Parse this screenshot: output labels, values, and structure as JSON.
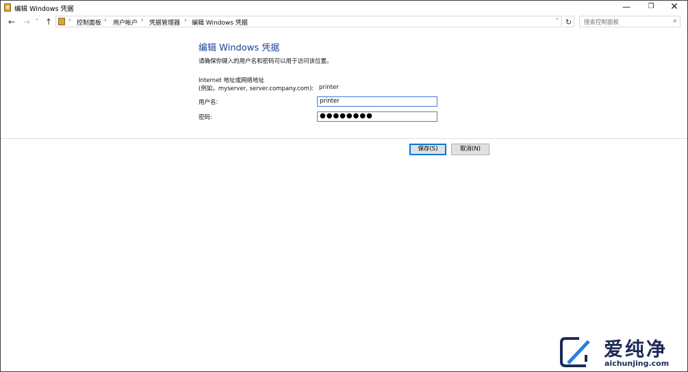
{
  "window": {
    "title": "编辑 Windows 凭据",
    "controls": {
      "minimize": "—",
      "maximize": "❐",
      "close": "✕"
    }
  },
  "nav": {
    "back": "←",
    "forward": "→",
    "recent": "˅",
    "up": "↑",
    "breadcrumbs": [
      "控制面板",
      "用户帐户",
      "凭据管理器",
      "编辑 Windows 凭据"
    ],
    "separator": "›",
    "dropdown": "˅",
    "refresh": "↻",
    "search_placeholder": "搜索控制面板",
    "search_icon": "⌕"
  },
  "form": {
    "heading": "编辑 Windows 凭据",
    "description": "请确保你键入的用户名和密码可以用于访问该位置。",
    "address_label_line1": "Internet 地址或网络地址",
    "address_label_line2": "(例如，myserver, server.company.com):",
    "address_value": "printer",
    "username_label": "用户名:",
    "username_value": "printer",
    "password_label": "密码:",
    "password_value": "●●●●●●●●"
  },
  "buttons": {
    "save": "保存(S)",
    "cancel": "取消(N)"
  },
  "watermark": {
    "chinese": "爱纯净",
    "english": "aichunjing.com"
  },
  "colors": {
    "heading": "#1e3f9a",
    "focus_border": "#0078d7",
    "watermark": "#1c2b55"
  }
}
